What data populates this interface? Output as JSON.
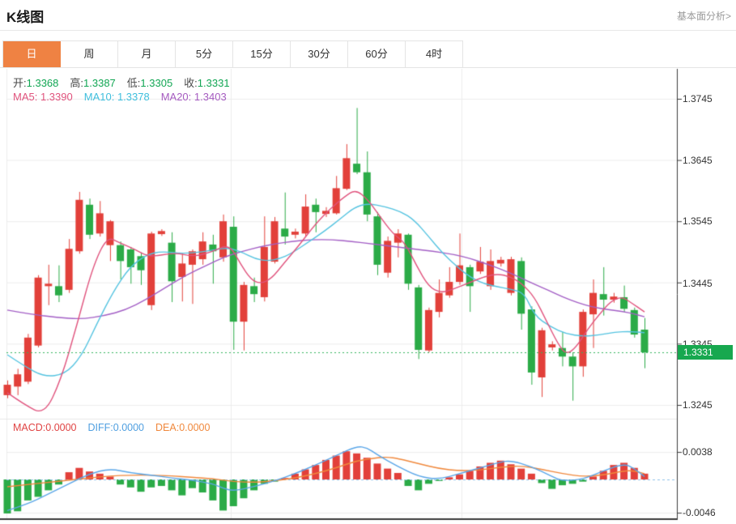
{
  "page": {
    "title": "K线图",
    "link": "基本面分析>"
  },
  "tabs": {
    "items": [
      {
        "label": "日",
        "selected": true
      },
      {
        "label": "周",
        "selected": false
      },
      {
        "label": "月",
        "selected": false
      },
      {
        "label": "5分",
        "selected": false
      },
      {
        "label": "15分",
        "selected": false
      },
      {
        "label": "30分",
        "selected": false
      },
      {
        "label": "60分",
        "selected": false
      },
      {
        "label": "4时",
        "selected": false
      }
    ]
  },
  "legend": {
    "ohlc": [
      {
        "label": "开:",
        "value": "1.3368"
      },
      {
        "label": "高:",
        "value": "1.3387"
      },
      {
        "label": "低:",
        "value": "1.3305"
      },
      {
        "label": "收:",
        "value": "1.3331"
      }
    ],
    "ma": [
      {
        "label": "MA5:",
        "value": "1.3390",
        "color": "#e0537d"
      },
      {
        "label": "MA10:",
        "value": "1.3378",
        "color": "#3fbfdd"
      },
      {
        "label": "MA20:",
        "value": "1.3403",
        "color": "#a55bc0"
      }
    ],
    "macd": [
      {
        "label": "MACD:",
        "value": "0.0000",
        "color": "#e04343"
      },
      {
        "label": "DIFF:",
        "value": "0.0000",
        "color": "#4f9fe0"
      },
      {
        "label": "DEA:",
        "value": "0.0000",
        "color": "#f0883c"
      }
    ]
  },
  "colors": {
    "up": "#e2403a",
    "down": "#2bab47",
    "ma5": "#e0537d",
    "ma10": "#54c3e0",
    "ma20": "#a35fc5",
    "diff": "#5aa6e8",
    "dea": "#f0883c",
    "grid": "#ececec",
    "axis": "#3a3a3a",
    "current_line": "#33b35c",
    "badge": "#17a84f",
    "zero_dash": "#8fc1e8",
    "tab_selected": "#ef8243"
  },
  "chart_data": {
    "type": "candlestick",
    "title": "K线图 日线 (daily K-line with MA5/MA10/MA20 and MACD)",
    "price_axis": {
      "ticks": [
        {
          "label": "1.3745",
          "value": 1.3745
        },
        {
          "label": "1.3645",
          "value": 1.3645
        },
        {
          "label": "1.3545",
          "value": 1.3545
        },
        {
          "label": "1.3445",
          "value": 1.3445
        },
        {
          "label": "1.3345",
          "value": 1.3345
        },
        {
          "label": "1.3245",
          "value": 1.3245
        }
      ],
      "current": {
        "label": "1.3331",
        "value": 1.3331
      }
    },
    "macd_axis": {
      "ticks": [
        {
          "label": "0.0038",
          "value": 0.0038
        },
        {
          "label": "-0.0046",
          "value": -0.0046
        }
      ],
      "zero": 0
    },
    "candles": [
      {
        "o": 1.3261,
        "h": 1.3285,
        "l": 1.3256,
        "c": 1.3278
      },
      {
        "o": 1.3275,
        "h": 1.3304,
        "l": 1.3261,
        "c": 1.3295
      },
      {
        "o": 1.3283,
        "h": 1.3361,
        "l": 1.3279,
        "c": 1.3355
      },
      {
        "o": 1.3342,
        "h": 1.3457,
        "l": 1.3339,
        "c": 1.3453
      },
      {
        "o": 1.3439,
        "h": 1.3474,
        "l": 1.3408,
        "c": 1.3443
      },
      {
        "o": 1.3439,
        "h": 1.3473,
        "l": 1.3413,
        "c": 1.3424
      },
      {
        "o": 1.3433,
        "h": 1.3516,
        "l": 1.3428,
        "c": 1.35
      },
      {
        "o": 1.3496,
        "h": 1.3593,
        "l": 1.3492,
        "c": 1.358
      },
      {
        "o": 1.3572,
        "h": 1.3582,
        "l": 1.3516,
        "c": 1.3523
      },
      {
        "o": 1.3525,
        "h": 1.3578,
        "l": 1.352,
        "c": 1.3558
      },
      {
        "o": 1.3506,
        "h": 1.3547,
        "l": 1.348,
        "c": 1.3545
      },
      {
        "o": 1.3506,
        "h": 1.3512,
        "l": 1.345,
        "c": 1.348
      },
      {
        "o": 1.3499,
        "h": 1.3503,
        "l": 1.3443,
        "c": 1.347
      },
      {
        "o": 1.3488,
        "h": 1.3494,
        "l": 1.3441,
        "c": 1.3465
      },
      {
        "o": 1.3408,
        "h": 1.3528,
        "l": 1.34,
        "c": 1.3525
      },
      {
        "o": 1.3524,
        "h": 1.3532,
        "l": 1.3521,
        "c": 1.3529
      },
      {
        "o": 1.351,
        "h": 1.3527,
        "l": 1.3413,
        "c": 1.3447
      },
      {
        "o": 1.3454,
        "h": 1.3492,
        "l": 1.3414,
        "c": 1.3476
      },
      {
        "o": 1.3474,
        "h": 1.3499,
        "l": 1.341,
        "c": 1.3496
      },
      {
        "o": 1.3483,
        "h": 1.3527,
        "l": 1.3474,
        "c": 1.3512
      },
      {
        "o": 1.3507,
        "h": 1.3523,
        "l": 1.3443,
        "c": 1.3496
      },
      {
        "o": 1.3486,
        "h": 1.3556,
        "l": 1.3479,
        "c": 1.3545
      },
      {
        "o": 1.3536,
        "h": 1.3553,
        "l": 1.3335,
        "c": 1.3381
      },
      {
        "o": 1.3381,
        "h": 1.3446,
        "l": 1.3334,
        "c": 1.3441
      },
      {
        "o": 1.3439,
        "h": 1.3453,
        "l": 1.3413,
        "c": 1.3426
      },
      {
        "o": 1.3421,
        "h": 1.3553,
        "l": 1.3414,
        "c": 1.3503
      },
      {
        "o": 1.3479,
        "h": 1.3552,
        "l": 1.3476,
        "c": 1.3545
      },
      {
        "o": 1.3533,
        "h": 1.3592,
        "l": 1.3507,
        "c": 1.352
      },
      {
        "o": 1.3523,
        "h": 1.3533,
        "l": 1.3517,
        "c": 1.3528
      },
      {
        "o": 1.3525,
        "h": 1.3589,
        "l": 1.352,
        "c": 1.3569
      },
      {
        "o": 1.3572,
        "h": 1.3582,
        "l": 1.3527,
        "c": 1.356
      },
      {
        "o": 1.3557,
        "h": 1.3568,
        "l": 1.3552,
        "c": 1.3562
      },
      {
        "o": 1.3558,
        "h": 1.3619,
        "l": 1.3556,
        "c": 1.3599
      },
      {
        "o": 1.3598,
        "h": 1.3671,
        "l": 1.3596,
        "c": 1.3648
      },
      {
        "o": 1.3639,
        "h": 1.373,
        "l": 1.3622,
        "c": 1.3625
      },
      {
        "o": 1.3625,
        "h": 1.3659,
        "l": 1.3545,
        "c": 1.3556
      },
      {
        "o": 1.3553,
        "h": 1.356,
        "l": 1.3457,
        "c": 1.3474
      },
      {
        "o": 1.3461,
        "h": 1.352,
        "l": 1.3453,
        "c": 1.3513
      },
      {
        "o": 1.351,
        "h": 1.3532,
        "l": 1.3486,
        "c": 1.3525
      },
      {
        "o": 1.3523,
        "h": 1.3525,
        "l": 1.3433,
        "c": 1.3443
      },
      {
        "o": 1.3437,
        "h": 1.3441,
        "l": 1.332,
        "c": 1.3335
      },
      {
        "o": 1.3334,
        "h": 1.3404,
        "l": 1.3331,
        "c": 1.34
      },
      {
        "o": 1.3397,
        "h": 1.345,
        "l": 1.3388,
        "c": 1.3428
      },
      {
        "o": 1.3424,
        "h": 1.347,
        "l": 1.342,
        "c": 1.3446
      },
      {
        "o": 1.3446,
        "h": 1.3525,
        "l": 1.3441,
        "c": 1.3473
      },
      {
        "o": 1.347,
        "h": 1.3474,
        "l": 1.3397,
        "c": 1.3439
      },
      {
        "o": 1.3463,
        "h": 1.3503,
        "l": 1.3459,
        "c": 1.3479
      },
      {
        "o": 1.3439,
        "h": 1.3499,
        "l": 1.3433,
        "c": 1.348
      },
      {
        "o": 1.3476,
        "h": 1.3487,
        "l": 1.3471,
        "c": 1.3482
      },
      {
        "o": 1.3428,
        "h": 1.3487,
        "l": 1.3424,
        "c": 1.3483
      },
      {
        "o": 1.348,
        "h": 1.3486,
        "l": 1.3368,
        "c": 1.3394
      },
      {
        "o": 1.3401,
        "h": 1.3406,
        "l": 1.3278,
        "c": 1.3298
      },
      {
        "o": 1.329,
        "h": 1.3371,
        "l": 1.3258,
        "c": 1.3367
      },
      {
        "o": 1.3339,
        "h": 1.3349,
        "l": 1.3334,
        "c": 1.3344
      },
      {
        "o": 1.3338,
        "h": 1.3364,
        "l": 1.3308,
        "c": 1.3324
      },
      {
        "o": 1.3324,
        "h": 1.3331,
        "l": 1.3252,
        "c": 1.3308
      },
      {
        "o": 1.3308,
        "h": 1.3401,
        "l": 1.3291,
        "c": 1.3397
      },
      {
        "o": 1.3393,
        "h": 1.345,
        "l": 1.3338,
        "c": 1.3428
      },
      {
        "o": 1.3426,
        "h": 1.347,
        "l": 1.3391,
        "c": 1.3417
      },
      {
        "o": 1.3417,
        "h": 1.3428,
        "l": 1.3412,
        "c": 1.3422
      },
      {
        "o": 1.3421,
        "h": 1.344,
        "l": 1.3397,
        "c": 1.3402
      },
      {
        "o": 1.34,
        "h": 1.3404,
        "l": 1.3355,
        "c": 1.336
      },
      {
        "o": 1.3368,
        "h": 1.3387,
        "l": 1.3305,
        "c": 1.3331
      }
    ],
    "ma5": [
      [
        0,
        1.3265
      ],
      [
        1.7,
        1.3245
      ],
      [
        3.6,
        1.3229
      ],
      [
        5.2,
        1.3285
      ],
      [
        6.8,
        1.3377
      ],
      [
        8.3,
        1.347
      ],
      [
        9.7,
        1.352
      ],
      [
        10.9,
        1.351
      ],
      [
        12.3,
        1.35
      ],
      [
        13.9,
        1.3486
      ],
      [
        16.2,
        1.3494
      ],
      [
        18.2,
        1.3487
      ],
      [
        19.9,
        1.3495
      ],
      [
        21.6,
        1.3508
      ],
      [
        22.7,
        1.3475
      ],
      [
        23.7,
        1.345
      ],
      [
        24.6,
        1.3443
      ],
      [
        25.7,
        1.3451
      ],
      [
        26.9,
        1.3476
      ],
      [
        28.4,
        1.3506
      ],
      [
        30,
        1.3541
      ],
      [
        31.4,
        1.3565
      ],
      [
        32.8,
        1.3585
      ],
      [
        33.9,
        1.3597
      ],
      [
        35.1,
        1.358
      ],
      [
        36.3,
        1.3552
      ],
      [
        37.5,
        1.3525
      ],
      [
        38.7,
        1.351
      ],
      [
        39.8,
        1.3473
      ],
      [
        41,
        1.3438
      ],
      [
        42.2,
        1.3428
      ],
      [
        43.4,
        1.3434
      ],
      [
        45,
        1.3445
      ],
      [
        46.5,
        1.3455
      ],
      [
        47.7,
        1.3459
      ],
      [
        48.9,
        1.3455
      ],
      [
        50.1,
        1.3443
      ],
      [
        51.3,
        1.3421
      ],
      [
        52.4,
        1.3384
      ],
      [
        53.6,
        1.3344
      ],
      [
        54.4,
        1.3327
      ],
      [
        55.4,
        1.334
      ],
      [
        56.4,
        1.3367
      ],
      [
        57.6,
        1.3393
      ],
      [
        58.7,
        1.3414
      ],
      [
        59.8,
        1.3422
      ],
      [
        60.7,
        1.3412
      ],
      [
        62,
        1.3397
      ]
    ],
    "ma10": [
      [
        0,
        1.3327
      ],
      [
        1.7,
        1.3308
      ],
      [
        3.6,
        1.3291
      ],
      [
        5.6,
        1.3295
      ],
      [
        7.2,
        1.3324
      ],
      [
        8.7,
        1.3377
      ],
      [
        10.3,
        1.343
      ],
      [
        11.9,
        1.347
      ],
      [
        13.5,
        1.349
      ],
      [
        15,
        1.3496
      ],
      [
        17,
        1.3492
      ],
      [
        19,
        1.3495
      ],
      [
        20.6,
        1.35
      ],
      [
        21.7,
        1.3501
      ],
      [
        22.9,
        1.3494
      ],
      [
        24.1,
        1.3484
      ],
      [
        25.3,
        1.348
      ],
      [
        26.5,
        1.3484
      ],
      [
        27.6,
        1.3492
      ],
      [
        29.2,
        1.351
      ],
      [
        30.8,
        1.3528
      ],
      [
        32.4,
        1.3549
      ],
      [
        33.8,
        1.3568
      ],
      [
        35.1,
        1.3574
      ],
      [
        36.7,
        1.3569
      ],
      [
        38.3,
        1.3561
      ],
      [
        39.6,
        1.3547
      ],
      [
        41,
        1.352
      ],
      [
        42.4,
        1.3492
      ],
      [
        43.8,
        1.347
      ],
      [
        45.1,
        1.3453
      ],
      [
        46.4,
        1.3443
      ],
      [
        47.7,
        1.3438
      ],
      [
        49,
        1.3434
      ],
      [
        50.3,
        1.3428
      ],
      [
        51.3,
        1.3391
      ],
      [
        52.8,
        1.3373
      ],
      [
        54.4,
        1.3361
      ],
      [
        56,
        1.3357
      ],
      [
        57.6,
        1.3359
      ],
      [
        59.1,
        1.3364
      ],
      [
        60.6,
        1.3365
      ],
      [
        62,
        1.3363
      ]
    ],
    "ma20": [
      [
        0,
        1.34
      ],
      [
        2.4,
        1.3393
      ],
      [
        4.8,
        1.3388
      ],
      [
        7.2,
        1.3385
      ],
      [
        9.5,
        1.3391
      ],
      [
        11.5,
        1.34
      ],
      [
        13.5,
        1.3417
      ],
      [
        15.4,
        1.3437
      ],
      [
        17.4,
        1.3457
      ],
      [
        19.4,
        1.3473
      ],
      [
        21.3,
        1.3488
      ],
      [
        22.9,
        1.3496
      ],
      [
        24.5,
        1.3503
      ],
      [
        26.1,
        1.3508
      ],
      [
        27.6,
        1.3512
      ],
      [
        29.6,
        1.3515
      ],
      [
        31.6,
        1.3515
      ],
      [
        33.5,
        1.3512
      ],
      [
        35.5,
        1.3508
      ],
      [
        37.5,
        1.3504
      ],
      [
        39.4,
        1.35
      ],
      [
        41.4,
        1.3496
      ],
      [
        43.4,
        1.3491
      ],
      [
        45.1,
        1.3484
      ],
      [
        46.7,
        1.3475
      ],
      [
        48.3,
        1.3465
      ],
      [
        49.9,
        1.3453
      ],
      [
        51.3,
        1.3442
      ],
      [
        52.7,
        1.3432
      ],
      [
        54.1,
        1.3421
      ],
      [
        55.5,
        1.3412
      ],
      [
        56.9,
        1.3405
      ],
      [
        58.3,
        1.3401
      ],
      [
        59.8,
        1.3398
      ],
      [
        60.9,
        1.3394
      ],
      [
        62,
        1.3389
      ]
    ],
    "macd_hist": [
      -0.0047,
      -0.0044,
      -0.0029,
      -0.0024,
      -0.0015,
      -0.0007,
      0.001,
      0.0016,
      0.0011,
      0.0008,
      0.0004,
      -0.0007,
      -0.0011,
      -0.0017,
      -0.0011,
      -0.0009,
      -0.0015,
      -0.0022,
      -0.0012,
      -0.0018,
      -0.0029,
      -0.0043,
      -0.0037,
      -0.0026,
      -0.0015,
      -0.0006,
      -0.0003,
      0.0002,
      0.0008,
      0.0014,
      0.002,
      0.0027,
      0.0033,
      0.0039,
      0.0036,
      0.003,
      0.0022,
      0.0015,
      0.0009,
      -0.0009,
      -0.0015,
      -0.0006,
      -0.0002,
      0.0003,
      0.0007,
      0.0012,
      0.0018,
      0.0023,
      0.0026,
      0.0021,
      0.0015,
      0.0008,
      -0.0005,
      -0.0013,
      -0.0008,
      -0.0006,
      -0.0003,
      0.0004,
      0.0012,
      0.002,
      0.0023,
      0.0016,
      0.0008
    ],
    "diff": [
      [
        0,
        -0.0043
      ],
      [
        2,
        -0.0034
      ],
      [
        4,
        -0.002
      ],
      [
        6,
        -0.0006
      ],
      [
        8,
        0.0008
      ],
      [
        10,
        0.0015
      ],
      [
        12,
        0.0009
      ],
      [
        14,
        0.0006
      ],
      [
        16,
        0.0002
      ],
      [
        18,
        -0.0001
      ],
      [
        20,
        -0.0006
      ],
      [
        21,
        -0.0012
      ],
      [
        22,
        -0.0016
      ],
      [
        24,
        -0.001
      ],
      [
        26,
        -0.0002
      ],
      [
        28,
        0.0008
      ],
      [
        30,
        0.002
      ],
      [
        32,
        0.0033
      ],
      [
        34,
        0.0046
      ],
      [
        35,
        0.0044
      ],
      [
        36,
        0.0034
      ],
      [
        38,
        0.0018
      ],
      [
        40,
        0.0004
      ],
      [
        42,
        0.0
      ],
      [
        44,
        0.0008
      ],
      [
        46,
        0.0016
      ],
      [
        48,
        0.0024
      ],
      [
        49,
        0.0026
      ],
      [
        51,
        0.0018
      ],
      [
        53,
        0.0004
      ],
      [
        54,
        -0.0002
      ],
      [
        56,
        0.0
      ],
      [
        58,
        0.0012
      ],
      [
        60,
        0.0022
      ],
      [
        61,
        0.0015
      ],
      [
        62,
        0.0004
      ]
    ],
    "dea": [
      [
        0,
        -0.001
      ],
      [
        2,
        -0.0007
      ],
      [
        4,
        -0.0004
      ],
      [
        6,
        -0.0001
      ],
      [
        8,
        0.0002
      ],
      [
        10,
        0.0005
      ],
      [
        12,
        0.0006
      ],
      [
        14,
        0.0006
      ],
      [
        16,
        0.0005
      ],
      [
        18,
        0.0003
      ],
      [
        20,
        0.0001
      ],
      [
        22,
        -0.0003
      ],
      [
        24,
        -0.0004
      ],
      [
        26,
        -0.0002
      ],
      [
        28,
        0.0002
      ],
      [
        30,
        0.0008
      ],
      [
        32,
        0.0016
      ],
      [
        34,
        0.0026
      ],
      [
        36,
        0.003
      ],
      [
        37,
        0.0031
      ],
      [
        38,
        0.0029
      ],
      [
        40,
        0.0022
      ],
      [
        42,
        0.0015
      ],
      [
        44,
        0.0012
      ],
      [
        46,
        0.0013
      ],
      [
        48,
        0.0017
      ],
      [
        50,
        0.0019
      ],
      [
        52,
        0.0014
      ],
      [
        54,
        0.0008
      ],
      [
        56,
        0.0004
      ],
      [
        58,
        0.0006
      ],
      [
        60,
        0.0012
      ],
      [
        61,
        0.0012
      ],
      [
        62,
        0.0008
      ]
    ]
  }
}
